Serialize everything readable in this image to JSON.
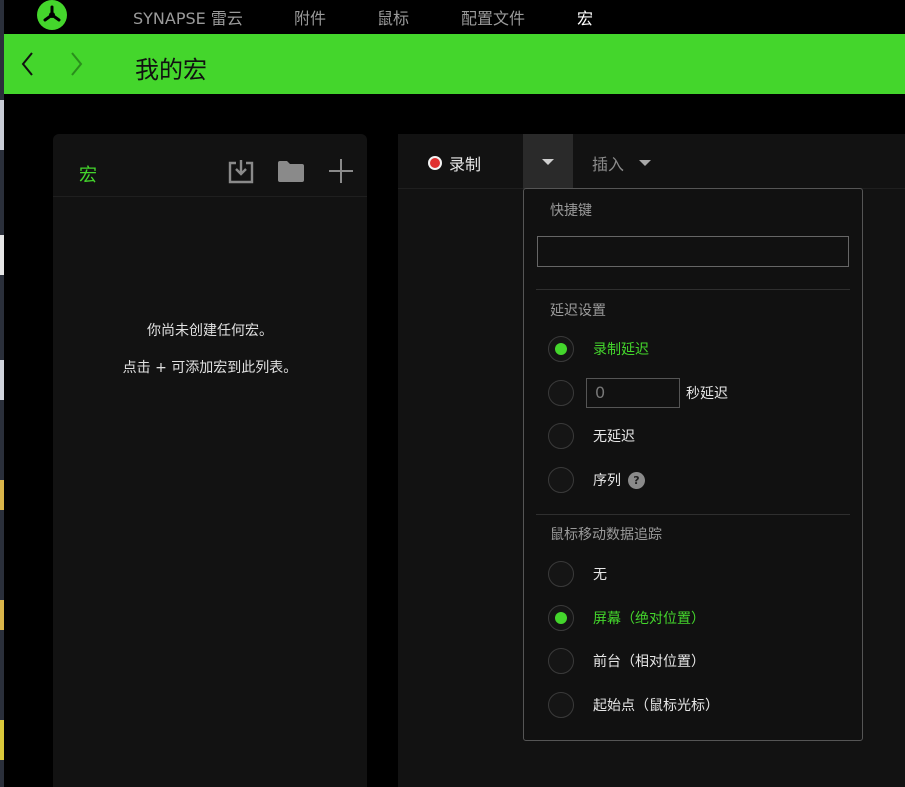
{
  "nav": {
    "items": [
      {
        "label": "SYNAPSE 雷云",
        "active": false
      },
      {
        "label": "附件",
        "active": false
      },
      {
        "label": "鼠标",
        "active": false
      },
      {
        "label": "配置文件",
        "active": false
      },
      {
        "label": "宏",
        "active": true
      }
    ]
  },
  "header": {
    "title": "我的宏",
    "back_icon": "chevron-left-icon",
    "forward_icon": "chevron-right-icon"
  },
  "macro_panel": {
    "title": "宏",
    "icons": [
      "import-icon",
      "folder-icon",
      "add-icon"
    ],
    "empty_line1": "你尚未创建任何宏。",
    "empty_line2": "点击 + 可添加宏到此列表。"
  },
  "toolbar": {
    "record_label": "录制",
    "insert_label": "插入"
  },
  "record_menu": {
    "hotkey_label": "快捷键",
    "hotkey_value": "",
    "delay_section": "延迟设置",
    "delay_options": [
      {
        "label": "录制延迟",
        "checked": true
      },
      {
        "label": "",
        "checked": false,
        "input_value": "0",
        "suffix": "秒延迟"
      },
      {
        "label": "无延迟",
        "checked": false
      },
      {
        "label": "序列",
        "checked": false,
        "help": "?"
      }
    ],
    "mouse_section": "鼠标移动数据追踪",
    "mouse_options": [
      {
        "label": "无",
        "checked": false
      },
      {
        "label": "屏幕（绝对位置）",
        "checked": true
      },
      {
        "label": "前台（相对位置）",
        "checked": false
      },
      {
        "label": "起始点（鼠标光标）",
        "checked": false
      }
    ]
  },
  "colors": {
    "accent": "#44d62c",
    "record": "#e03030",
    "panel": "#121212",
    "background": "#000000"
  }
}
